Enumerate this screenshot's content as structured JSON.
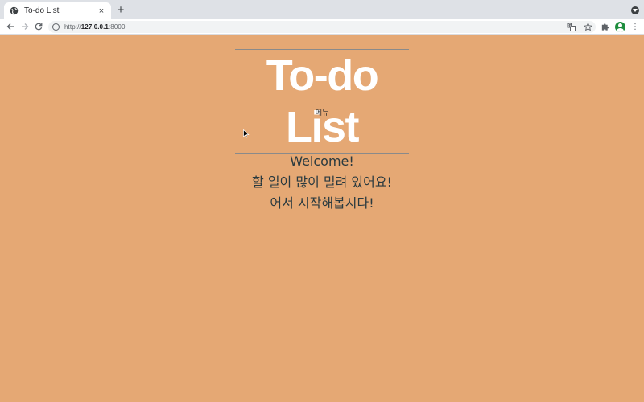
{
  "browser": {
    "tab": {
      "title": "To-do List",
      "close_glyph": "×"
    },
    "new_tab_glyph": "+",
    "url": {
      "scheme": "http://",
      "host": "127.0.0.1",
      "port": ":8000"
    }
  },
  "page": {
    "title": "To-do List",
    "menu_label": "메뉴",
    "welcome_lines": [
      "Welcome!",
      "할 일이 많이 밀려 있어요!",
      "어서 시작해봅시다!"
    ]
  },
  "colors": {
    "background": "#e5a874",
    "title": "#ffffff",
    "text": "#2a3a3f"
  },
  "icons": {
    "favicon": "globe-icon",
    "back": "back-arrow-icon",
    "forward": "forward-arrow-icon",
    "reload": "reload-icon",
    "site_info": "info-icon",
    "translate": "translate-icon",
    "bookmark": "star-icon",
    "extensions": "puzzle-icon",
    "profile": "avatar-icon",
    "menu": "kebab-menu-icon"
  }
}
